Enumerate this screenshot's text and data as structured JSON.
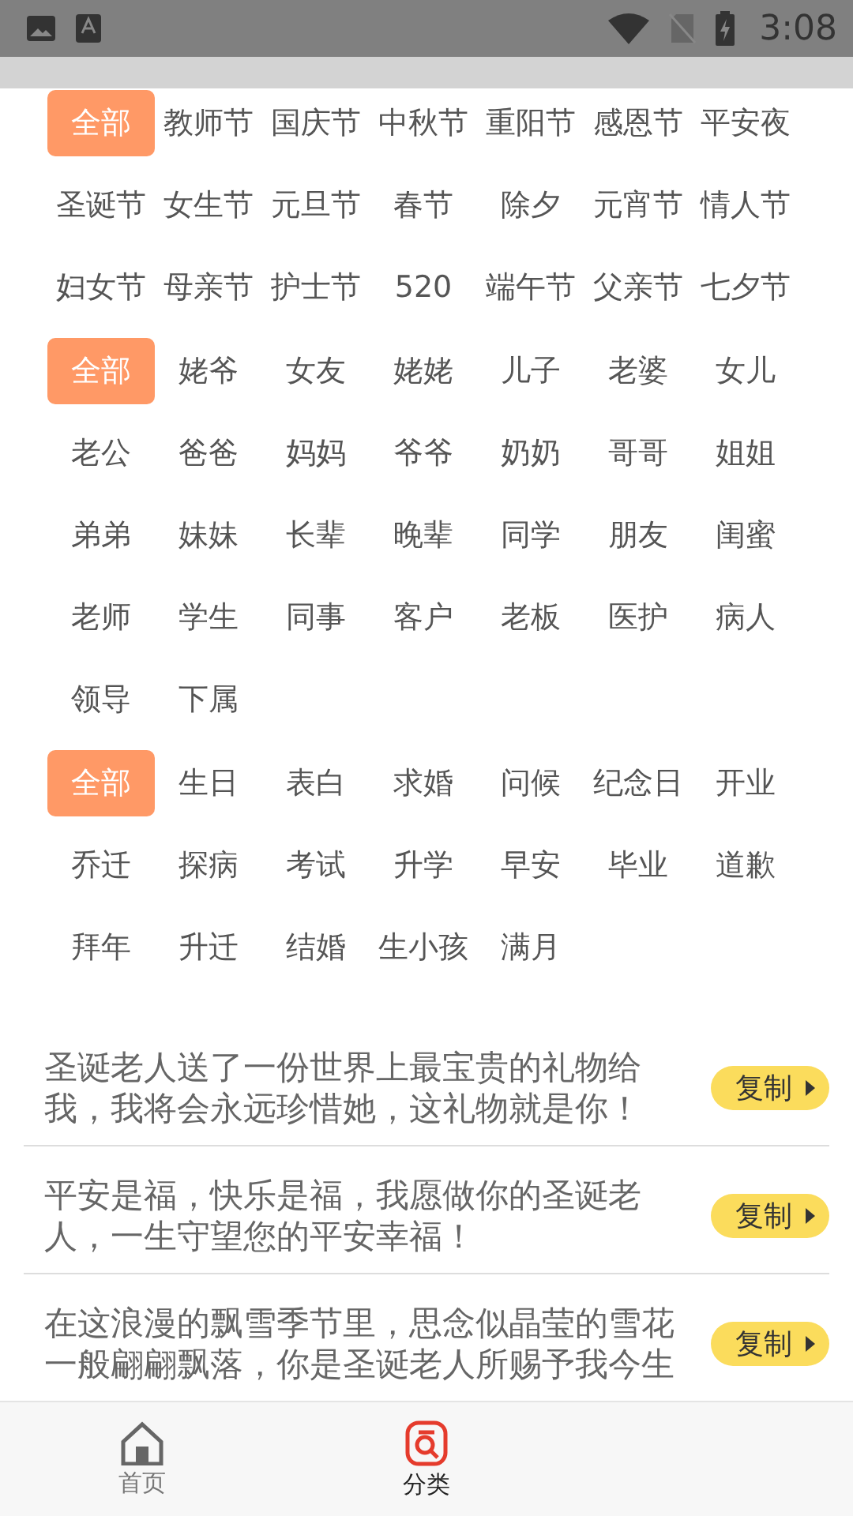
{
  "status_bar": {
    "time": "3:08"
  },
  "tag_groups": [
    {
      "tags": [
        {
          "label": "全部",
          "selected": true
        },
        {
          "label": "教师节",
          "selected": false
        },
        {
          "label": "国庆节",
          "selected": false
        },
        {
          "label": "中秋节",
          "selected": false
        },
        {
          "label": "重阳节",
          "selected": false
        },
        {
          "label": "感恩节",
          "selected": false
        },
        {
          "label": "平安夜",
          "selected": false
        },
        {
          "label": "圣诞节",
          "selected": false
        },
        {
          "label": "女生节",
          "selected": false
        },
        {
          "label": "元旦节",
          "selected": false
        },
        {
          "label": "春节",
          "selected": false
        },
        {
          "label": "除夕",
          "selected": false
        },
        {
          "label": "元宵节",
          "selected": false
        },
        {
          "label": "情人节",
          "selected": false
        },
        {
          "label": "妇女节",
          "selected": false
        },
        {
          "label": "母亲节",
          "selected": false
        },
        {
          "label": "护士节",
          "selected": false
        },
        {
          "label": "520",
          "selected": false
        },
        {
          "label": "端午节",
          "selected": false
        },
        {
          "label": "父亲节",
          "selected": false
        },
        {
          "label": "七夕节",
          "selected": false
        }
      ]
    },
    {
      "tags": [
        {
          "label": "全部",
          "selected": true
        },
        {
          "label": "姥爷",
          "selected": false
        },
        {
          "label": "女友",
          "selected": false
        },
        {
          "label": "姥姥",
          "selected": false
        },
        {
          "label": "儿子",
          "selected": false
        },
        {
          "label": "老婆",
          "selected": false
        },
        {
          "label": "女儿",
          "selected": false
        },
        {
          "label": "老公",
          "selected": false
        },
        {
          "label": "爸爸",
          "selected": false
        },
        {
          "label": "妈妈",
          "selected": false
        },
        {
          "label": "爷爷",
          "selected": false
        },
        {
          "label": "奶奶",
          "selected": false
        },
        {
          "label": "哥哥",
          "selected": false
        },
        {
          "label": "姐姐",
          "selected": false
        },
        {
          "label": "弟弟",
          "selected": false
        },
        {
          "label": "妹妹",
          "selected": false
        },
        {
          "label": "长辈",
          "selected": false
        },
        {
          "label": "晚辈",
          "selected": false
        },
        {
          "label": "同学",
          "selected": false
        },
        {
          "label": "朋友",
          "selected": false
        },
        {
          "label": "闺蜜",
          "selected": false
        },
        {
          "label": "老师",
          "selected": false
        },
        {
          "label": "学生",
          "selected": false
        },
        {
          "label": "同事",
          "selected": false
        },
        {
          "label": "客户",
          "selected": false
        },
        {
          "label": "老板",
          "selected": false
        },
        {
          "label": "医护",
          "selected": false
        },
        {
          "label": "病人",
          "selected": false
        },
        {
          "label": "领导",
          "selected": false
        },
        {
          "label": "下属",
          "selected": false
        }
      ]
    },
    {
      "tags": [
        {
          "label": "全部",
          "selected": true
        },
        {
          "label": "生日",
          "selected": false
        },
        {
          "label": "表白",
          "selected": false
        },
        {
          "label": "求婚",
          "selected": false
        },
        {
          "label": "问候",
          "selected": false
        },
        {
          "label": "纪念日",
          "selected": false
        },
        {
          "label": "开业",
          "selected": false
        },
        {
          "label": "乔迁",
          "selected": false
        },
        {
          "label": "探病",
          "selected": false
        },
        {
          "label": "考试",
          "selected": false
        },
        {
          "label": "升学",
          "selected": false
        },
        {
          "label": "早安",
          "selected": false
        },
        {
          "label": "毕业",
          "selected": false
        },
        {
          "label": "道歉",
          "selected": false
        },
        {
          "label": "拜年",
          "selected": false
        },
        {
          "label": "升迁",
          "selected": false
        },
        {
          "label": "结婚",
          "selected": false
        },
        {
          "label": "生小孩",
          "selected": false
        },
        {
          "label": "满月",
          "selected": false
        }
      ]
    }
  ],
  "messages": [
    {
      "text": "圣诞老人送了一份世界上最宝贵的礼物给我，我将会永远珍惜她，这礼物就是你！",
      "button": "复制"
    },
    {
      "text": "平安是福，快乐是福，我愿做你的圣诞老人，一生守望您的平安幸福！",
      "button": "复制"
    },
    {
      "text": "在这浪漫的飘雪季节里，思念似晶莹的雪花一般翩翩飘落，你是圣诞老人所赐予我今生",
      "button": "复制"
    }
  ],
  "nav": [
    {
      "kind": "home",
      "label": "首页",
      "selected": false
    },
    {
      "kind": "category",
      "label": "分类",
      "selected": true
    }
  ]
}
